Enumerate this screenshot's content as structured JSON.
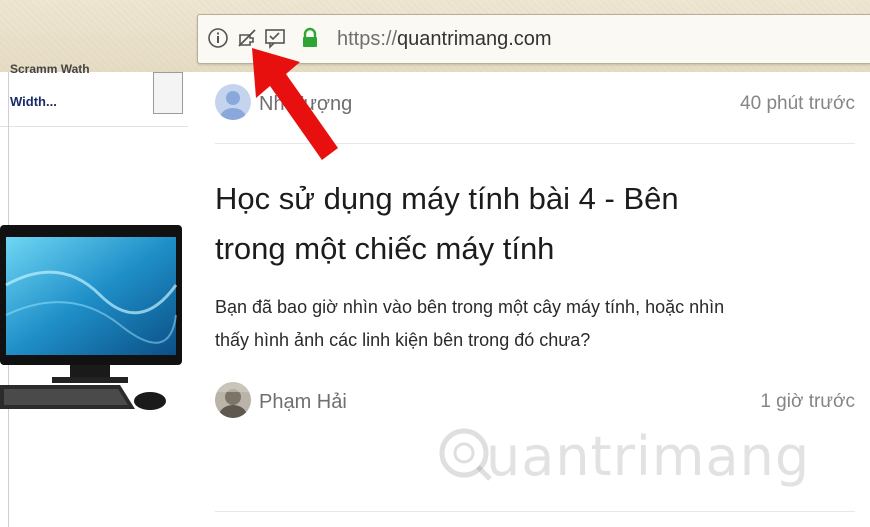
{
  "browser": {
    "url_scheme": "https://",
    "url_host": "quantrimang.com",
    "icons": [
      "info-icon",
      "blocked-plugin-icon",
      "message-icon",
      "lock-icon"
    ],
    "accent_lock": "#2fa535"
  },
  "left_panel": {
    "cut_text": "Scramm Wath",
    "width_text": "Width..."
  },
  "posts": [
    {
      "author": "Nh       Vượng",
      "time": "40 phút trước"
    },
    {
      "title_line1": "Học sử dụng máy tính bài 4 - Bên",
      "title_line2": "trong một chiếc máy tính",
      "excerpt_line1": "Bạn đã bao giờ nhìn vào bên trong một cây máy tính, hoặc nhìn",
      "excerpt_line2": "thấy hình ảnh các linh kiện bên trong đó chưa?",
      "author": "Phạm Hải",
      "time": "1 giờ trước"
    }
  ],
  "watermark": "uantrimang",
  "annotation_color": "#e8100f"
}
